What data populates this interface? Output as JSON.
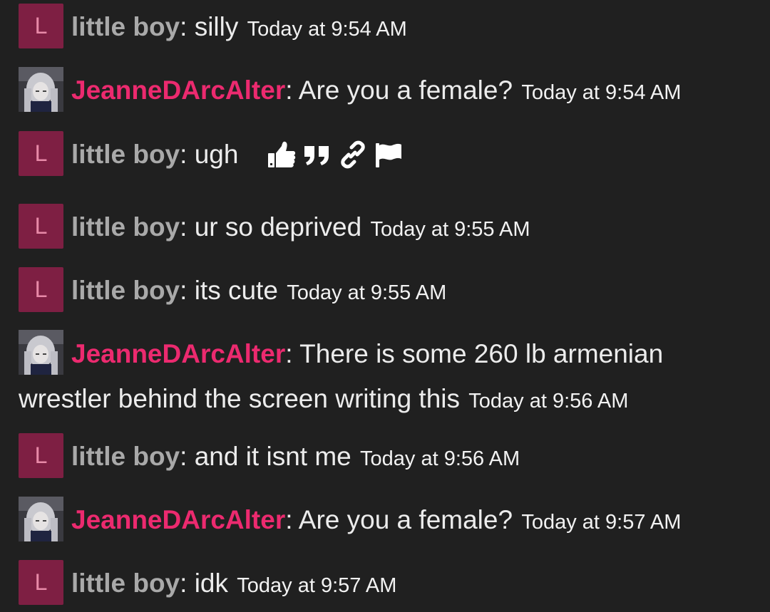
{
  "messages": [
    {
      "avatar_letter": "L",
      "username": "little boy",
      "colon": ":",
      "text": "silly",
      "timestamp": "Today at 9:54 AM"
    },
    {
      "avatar_letter": "",
      "username": "JeanneDArcAlter",
      "colon": ":",
      "text": "Are you a female?",
      "timestamp": "Today at 9:54 AM"
    },
    {
      "avatar_letter": "L",
      "username": "little boy",
      "colon": ":",
      "text": "ugh",
      "timestamp": ""
    },
    {
      "avatar_letter": "L",
      "username": "little boy",
      "colon": ":",
      "text": "ur so deprived",
      "timestamp": "Today at 9:55 AM"
    },
    {
      "avatar_letter": "L",
      "username": "little boy",
      "colon": ":",
      "text": "its cute",
      "timestamp": "Today at 9:55 AM"
    },
    {
      "avatar_letter": "",
      "username": "JeanneDArcAlter",
      "colon": ":",
      "text": "There is some 260 lb armenian wrestler behind the screen writing this",
      "timestamp": "Today at 9:56 AM"
    },
    {
      "avatar_letter": "L",
      "username": "little boy",
      "colon": ":",
      "text": "and it isnt me",
      "timestamp": "Today at 9:56 AM"
    },
    {
      "avatar_letter": "",
      "username": "JeanneDArcAlter",
      "colon": ":",
      "text": "Are you a female?",
      "timestamp": "Today at 9:57 AM"
    },
    {
      "avatar_letter": "L",
      "username": "little boy",
      "colon": ":",
      "text": "idk",
      "timestamp": "Today at 9:57 AM"
    }
  ],
  "hover_actions": [
    "thumbs-up-icon",
    "quote-icon",
    "link-icon",
    "flag-icon"
  ],
  "colors": {
    "background": "#202020",
    "little_boy_name": "#a9a9a9",
    "jeanne_name": "#ec2a6f",
    "letter_avatar_bg": "#7e1f43",
    "letter_avatar_fg": "#e88aa8",
    "text": "#ececec"
  }
}
